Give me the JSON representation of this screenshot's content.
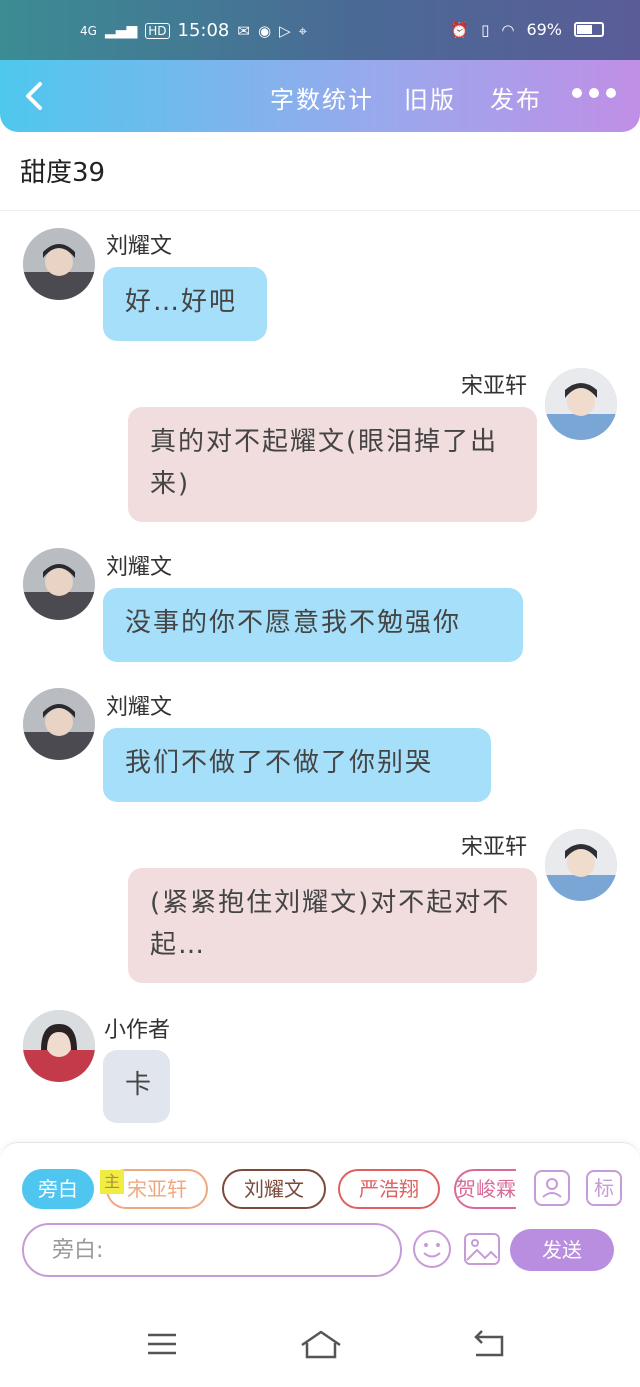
{
  "status_bar": {
    "network": "4G",
    "hd": "HD",
    "time": "15:08",
    "battery_percent": 69,
    "battery_text": "69%"
  },
  "header": {
    "back_icon": "chevron-left",
    "menu": [
      "字数统计",
      "旧版",
      "发布"
    ],
    "more_icon": "more-dots"
  },
  "story": {
    "title": "甜度39"
  },
  "messages": [
    {
      "side": "left",
      "speaker": "刘耀文",
      "text": "好…好吧",
      "style": "blue"
    },
    {
      "side": "right",
      "speaker": "宋亚轩",
      "text": "真的对不起耀文(眼泪掉了出来)",
      "style": "pink"
    },
    {
      "side": "left",
      "speaker": "刘耀文",
      "text": "没事的你不愿意我不勉强你",
      "style": "blue"
    },
    {
      "side": "left",
      "speaker": "刘耀文",
      "text": "我们不做了不做了你别哭",
      "style": "blue"
    },
    {
      "side": "right",
      "speaker": "宋亚轩",
      "text": "(紧紧抱住刘耀文)对不起对不起…",
      "style": "pink"
    },
    {
      "side": "left",
      "speaker": "小作者",
      "text": "卡",
      "style": "gray"
    }
  ],
  "roles": {
    "narration": "旁白",
    "host_badge": "主",
    "chips": [
      "宋亚轩",
      "刘耀文",
      "严浩翔",
      "贺峻霖"
    ],
    "chip_colors": [
      "#f0a880",
      "#7a4a3a",
      "#e06060",
      "#d86a9a"
    ],
    "add_role_icon": "person-icon",
    "tag_label": "标"
  },
  "composer": {
    "placeholder": "旁白:",
    "emoji_icon": "emoji-icon",
    "image_icon": "image-icon",
    "send_label": "发送"
  },
  "colors": {
    "accent_blue": "#4fc6ef",
    "accent_purple": "#b98ddf",
    "bubble_blue": "#a6dffa",
    "bubble_pink": "#f1dddd",
    "bubble_gray": "#e0e5ee"
  }
}
